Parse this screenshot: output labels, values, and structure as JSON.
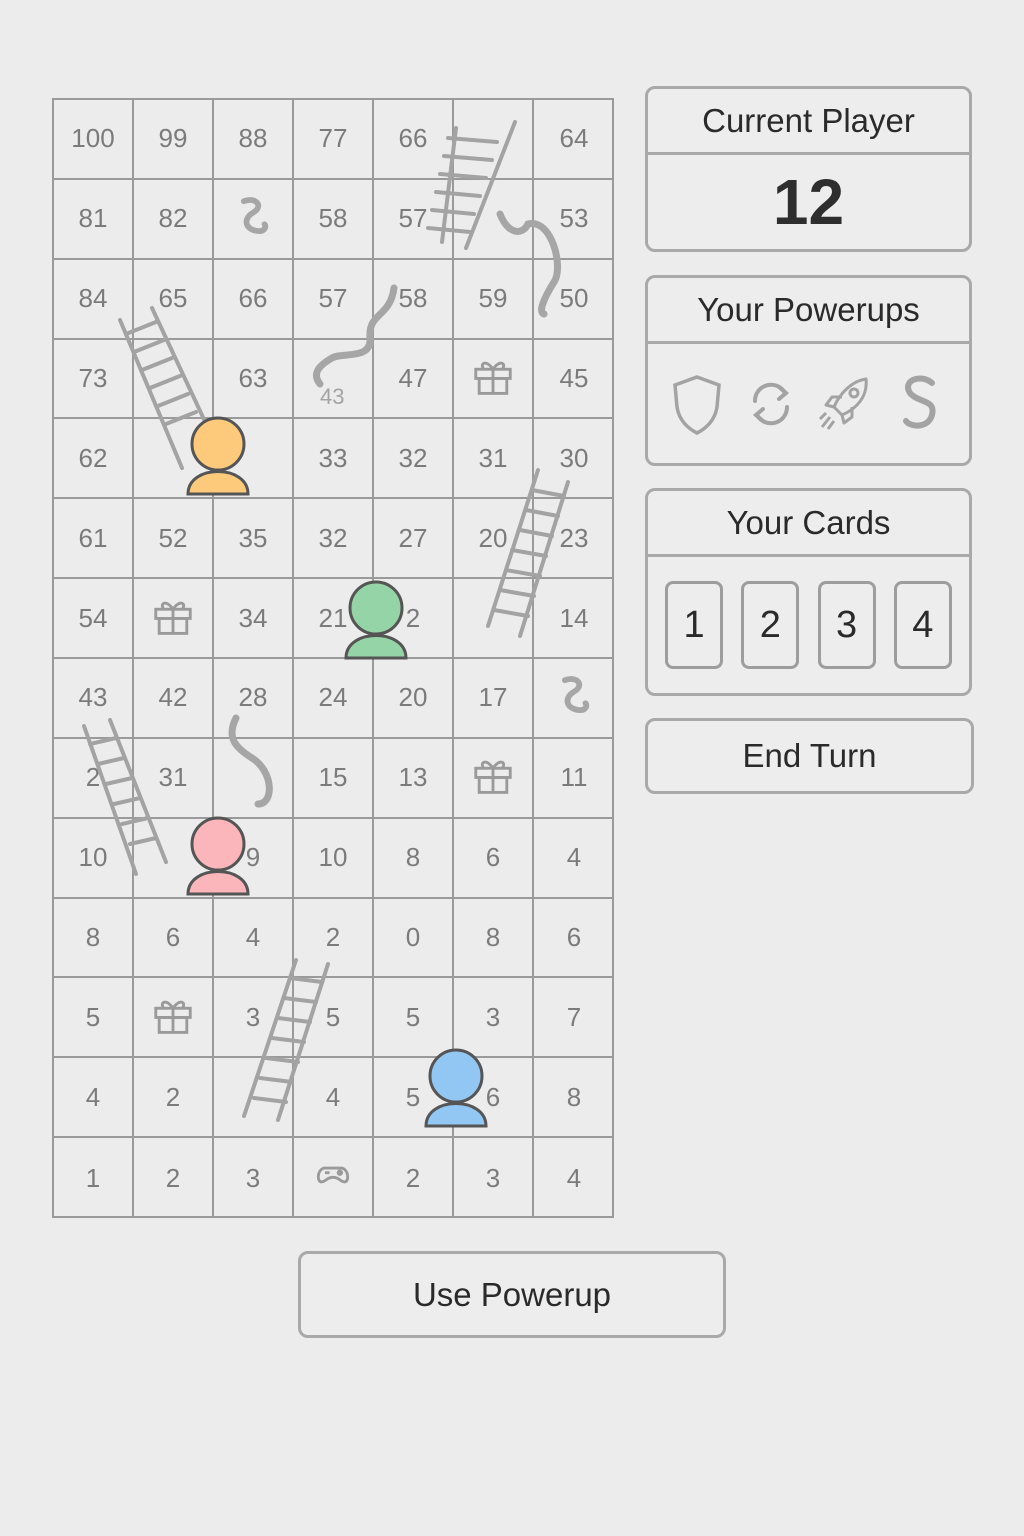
{
  "board": {
    "rows": [
      [
        "100",
        "99",
        "88",
        "77",
        "66",
        "",
        "64"
      ],
      [
        "81",
        "82",
        "",
        "58",
        "57",
        "",
        "53"
      ],
      [
        "84",
        "65",
        "66",
        "57",
        "58",
        "59",
        "50"
      ],
      [
        "73",
        "",
        "63",
        "",
        "47",
        "",
        "45"
      ],
      [
        "62",
        "",
        "",
        "33",
        "32",
        "31",
        "30"
      ],
      [
        "61",
        "52",
        "35",
        "32",
        "27",
        "20",
        "23"
      ],
      [
        "54",
        "",
        "34",
        "21",
        "2",
        "",
        "14"
      ],
      [
        "43",
        "42",
        "28",
        "24",
        "20",
        "17",
        ""
      ],
      [
        "2",
        "31",
        "",
        "15",
        "13",
        "",
        "11"
      ],
      [
        "10",
        "",
        "9",
        "10",
        "8",
        "6",
        "4"
      ],
      [
        "8",
        "6",
        "4",
        "2",
        "0",
        "8",
        "6"
      ],
      [
        "5",
        "",
        "3",
        "5",
        "5",
        "3",
        "7"
      ],
      [
        "4",
        "2",
        "",
        "4",
        "5",
        "6",
        "8"
      ],
      [
        "1",
        "2",
        "3",
        "",
        "2",
        "3",
        "4"
      ]
    ],
    "special_cells": [
      {
        "row": 3,
        "col": 5,
        "icon": "gift-icon"
      },
      {
        "row": 6,
        "col": 1,
        "icon": "gift-icon"
      },
      {
        "row": 8,
        "col": 5,
        "icon": "gift-icon"
      },
      {
        "row": 11,
        "col": 1,
        "icon": "gift-icon"
      },
      {
        "row": 1,
        "col": 2,
        "icon": "snake-icon"
      },
      {
        "row": 7,
        "col": 6,
        "icon": "snake-icon"
      },
      {
        "row": 13,
        "col": 3,
        "icon": "gamepad-icon"
      }
    ],
    "snake_label": "43",
    "tokens": [
      {
        "name": "yellow-player-token",
        "color": "#fdca7c"
      },
      {
        "name": "green-player-token",
        "color": "#95d4a6"
      },
      {
        "name": "pink-player-token",
        "color": "#fab6bb"
      },
      {
        "name": "blue-player-token",
        "color": "#92c7f3"
      }
    ]
  },
  "current_player": {
    "title": "Current Player",
    "value": "12"
  },
  "powerups": {
    "title": "Your Powerups",
    "items": [
      "shield-icon",
      "refresh-icon",
      "rocket-icon",
      "snake-icon"
    ]
  },
  "cards": {
    "title": "Your Cards",
    "items": [
      "1",
      "2",
      "3",
      "4"
    ]
  },
  "buttons": {
    "end_turn": "End Turn",
    "use_powerup": "Use Powerup"
  }
}
